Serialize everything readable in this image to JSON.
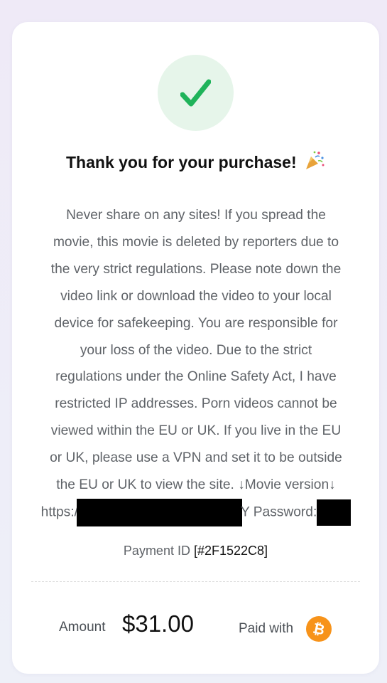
{
  "confirmation": {
    "title": "Thank you for your purchase!",
    "title_icon": "party-popper-icon",
    "status_icon": "checkmark-icon",
    "status_color": "#1fb35a"
  },
  "message": {
    "lines": [
      "Never share on any sites! If you spread the",
      "movie, this movie is deleted by reporters due to",
      "the very strict regulations. Please note down the",
      "video link or download the video to your local",
      "device for safekeeping. You are responsible for",
      "your loss of the video. Due to the strict",
      "regulations under the Online Safety Act, I have",
      "restricted IP addresses. Porn videos cannot be",
      "viewed within the EU or UK. If you live in the EU",
      "or UK, please use a VPN and set it to be outside",
      "the EU or UK to view the site. ↓Movie version↓"
    ],
    "url_prefix": "https:",
    "url_slash": "/",
    "password_prefix": "Y Password:"
  },
  "payment": {
    "label": "Payment ID",
    "id": "[#2F1522C8]"
  },
  "summary": {
    "amount_label": "Amount",
    "amount_value": "$31.00",
    "paid_with_label": "Paid with",
    "paid_with_icon": "bitcoin-icon",
    "bitcoin_color": "#f7931a"
  }
}
